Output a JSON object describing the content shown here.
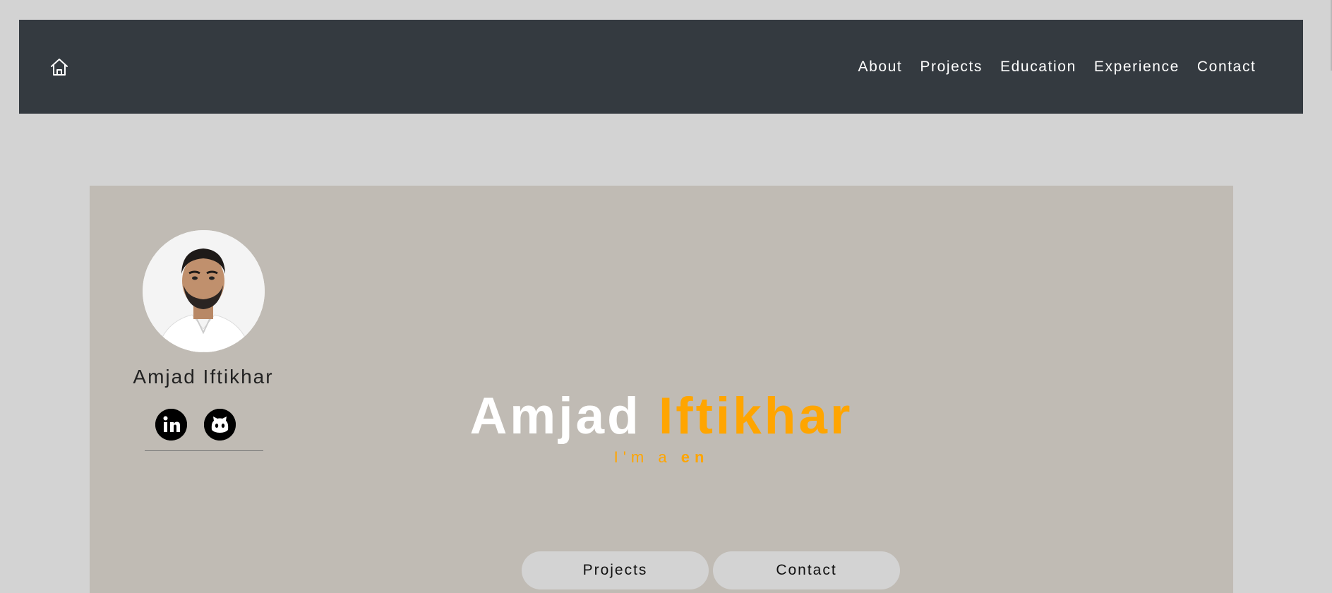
{
  "nav": {
    "home_icon": "home-icon",
    "links": [
      "About",
      "Projects",
      "Education",
      "Experience",
      "Contact"
    ]
  },
  "profile": {
    "name": "Amjad Iftikhar",
    "socials": [
      "linkedin-icon",
      "github-icon"
    ]
  },
  "hero": {
    "first_name": "Amjad",
    "last_name": "Iftikhar",
    "typing_prefix": "I'm a ",
    "typing_text": "en"
  },
  "buttons": {
    "projects_label": "Projects",
    "contact_label": "Contact"
  },
  "colors": {
    "navbar": "#343a40",
    "page_bg": "#d3d3d3",
    "hero_bg": "#c0bbb4",
    "accent": "#ffa500"
  }
}
